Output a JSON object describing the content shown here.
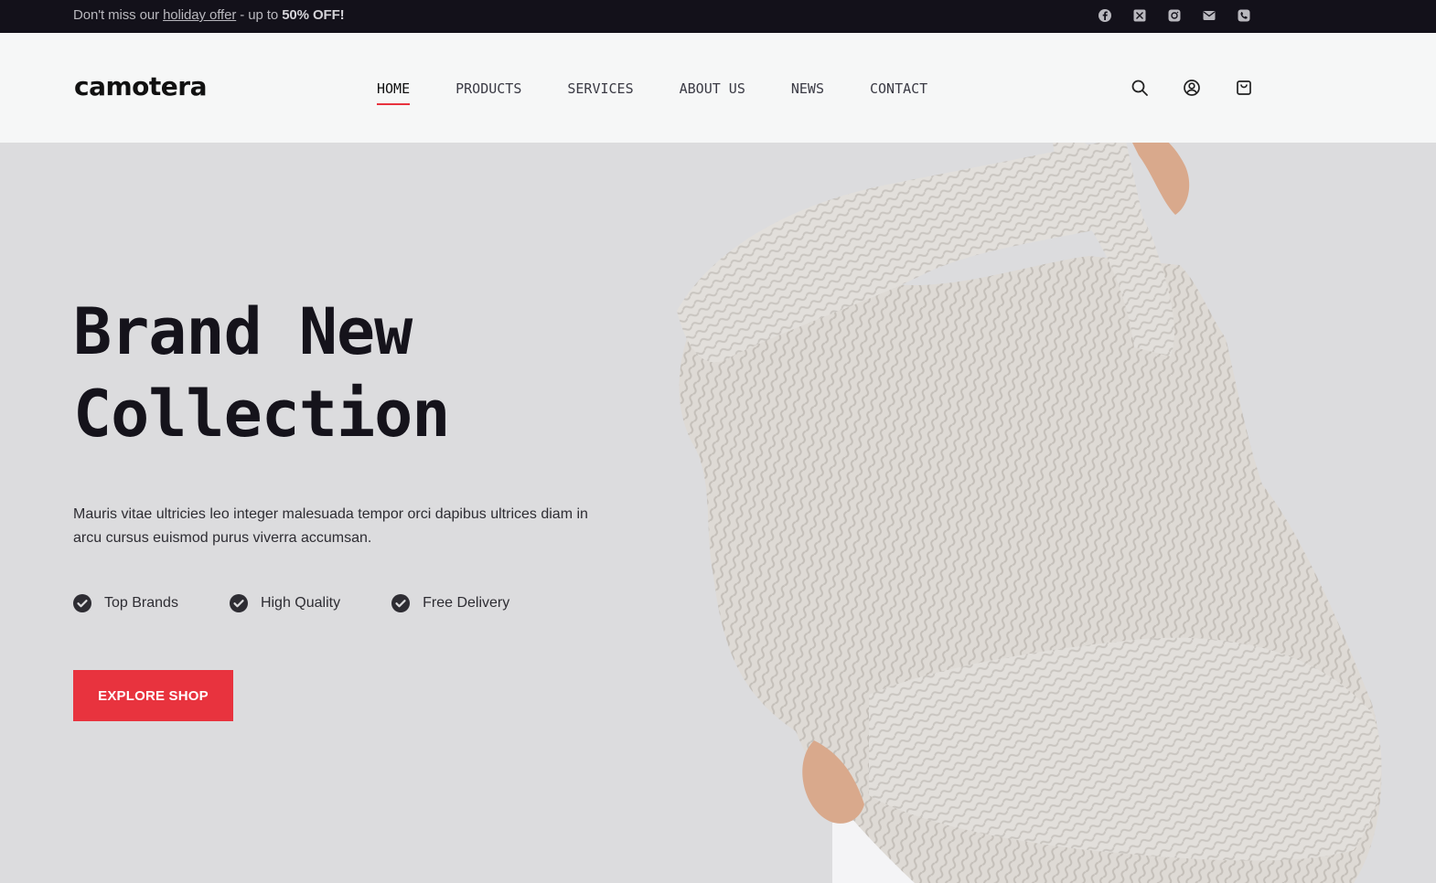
{
  "topbar": {
    "promo_prefix": "Don't miss our ",
    "promo_link": "holiday offer",
    "promo_middle": " - up to ",
    "promo_bold": "50% OFF!",
    "socials": [
      "facebook-icon",
      "x-twitter-icon",
      "instagram-icon",
      "email-icon",
      "phone-icon"
    ]
  },
  "header": {
    "logo": "camotera",
    "nav": [
      "HOME",
      "PRODUCTS",
      "SERVICES",
      "ABOUT US",
      "NEWS",
      "CONTACT"
    ],
    "active_nav": "HOME",
    "icons": [
      "search-icon",
      "account-icon",
      "cart-icon"
    ]
  },
  "hero": {
    "title_line1": "Brand New",
    "title_line2": "Collection",
    "description": "Mauris vitae ultricies leo integer malesuada tempor orci dapibus ultrices diam in arcu cursus euismod purus viverra accumsan.",
    "features": [
      "Top Brands",
      "High Quality",
      "Free Delivery"
    ],
    "cta": "EXPLORE SHOP"
  },
  "colors": {
    "accent": "#e8333e",
    "topbar_bg": "#13111a",
    "hero_bg": "#dcdcde",
    "header_bg": "#f6f7f7"
  }
}
